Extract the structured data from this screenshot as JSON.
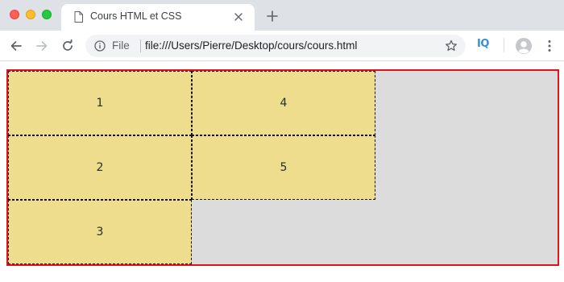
{
  "tab": {
    "title": "Cours HTML et CSS"
  },
  "address_bar": {
    "scheme_label": "File",
    "url": "file:///Users/Pierre/Desktop/cours/cours.html"
  },
  "extension": {
    "label": "IQ"
  },
  "page": {
    "grid_items": [
      "1",
      "2",
      "3",
      "4",
      "5"
    ]
  },
  "colors": {
    "container_border": "#e4101a",
    "container_background": "#dcdcdc",
    "item_background": "#eddd8c"
  }
}
